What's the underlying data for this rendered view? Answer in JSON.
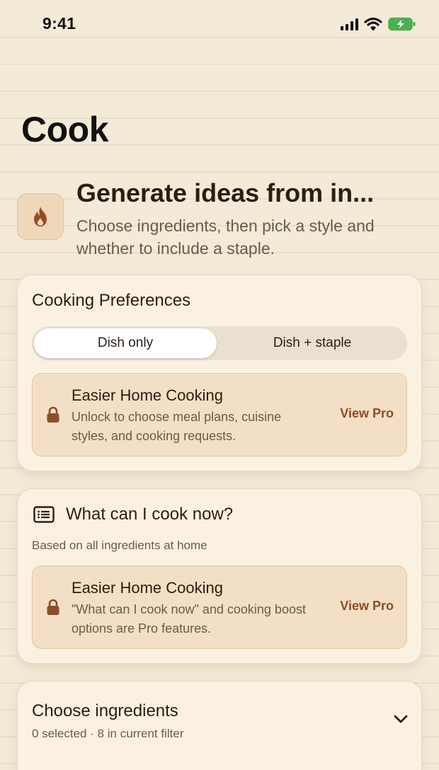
{
  "status_bar": {
    "time": "9:41",
    "icons": [
      "signal-icon",
      "wifi-icon",
      "battery-charging-icon"
    ],
    "battery_color": "#4caf50"
  },
  "page": {
    "title": "Cook"
  },
  "hero": {
    "icon": "flame-icon",
    "title": "Generate ideas from in...",
    "subtitle": "Choose ingredients, then pick a style and whether to include a staple."
  },
  "preferences": {
    "title": "Cooking Preferences",
    "options": [
      "Dish only",
      "Dish + staple"
    ],
    "selected": "Dish only",
    "pro_box": {
      "icon": "lock-icon",
      "title": "Easier Home Cooking",
      "description": "Unlock to choose meal plans, cuisine styles, and cooking requests.",
      "action": "View Pro"
    }
  },
  "cook_now": {
    "icon": "list-icon",
    "title": "What can I cook now?",
    "subtitle": "Based on all ingredients at home",
    "pro_box": {
      "icon": "lock-icon",
      "title": "Easier Home Cooking",
      "description": "\"What can I cook now\" and cooking boost options are Pro features.",
      "action": "View Pro"
    }
  },
  "ingredients": {
    "title": "Choose ingredients",
    "summary": "0 selected · 8 in current filter",
    "toggle_icon": "chevron-down-icon"
  },
  "colors": {
    "background": "#f4ead8",
    "card": "#fbf1e3",
    "pro_box": "#f3dfc5",
    "accent": "#8a4f27",
    "text_primary": "#2c1d12",
    "text_secondary": "#6d5a48"
  }
}
